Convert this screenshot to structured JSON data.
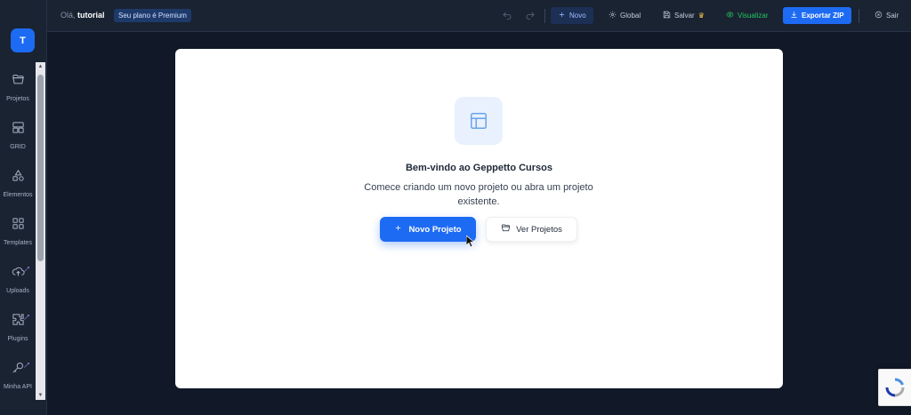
{
  "sidebar": {
    "logo_letter": "T",
    "items": [
      {
        "label": "Projetos",
        "icon": "folder-icon"
      },
      {
        "label": "GRID",
        "icon": "grid-layout-icon"
      },
      {
        "label": "Elementos",
        "icon": "shapes-icon"
      },
      {
        "label": "Templates",
        "icon": "templates-icon"
      },
      {
        "label": "Uploads",
        "icon": "cloud-upload-icon"
      },
      {
        "label": "Plugins",
        "icon": "puzzle-icon"
      },
      {
        "label": "Minha API",
        "icon": "key-icon"
      }
    ]
  },
  "topbar": {
    "greeting_prefix": "Olá,",
    "username": "tutorial",
    "plan_badge": "Seu plano é Premium",
    "novo_label": "Novo",
    "global_label": "Global",
    "salvar_label": "Salvar",
    "visualizar_label": "Visualizar",
    "exportar_label": "Exportar ZIP",
    "sair_label": "Sair"
  },
  "main": {
    "welcome_title": "Bem-vindo ao Geppetto Cursos",
    "description": "Comece criando um novo projeto ou abra um projeto existente.",
    "new_project_label": "Novo Projeto",
    "view_projects_label": "Ver Projetos"
  },
  "colors": {
    "accent": "#1d6bf3",
    "sidebar_bg": "#1a2332",
    "page_bg": "#111827",
    "visualize_green": "#22c55e",
    "premium_crown": "#f5c542"
  }
}
